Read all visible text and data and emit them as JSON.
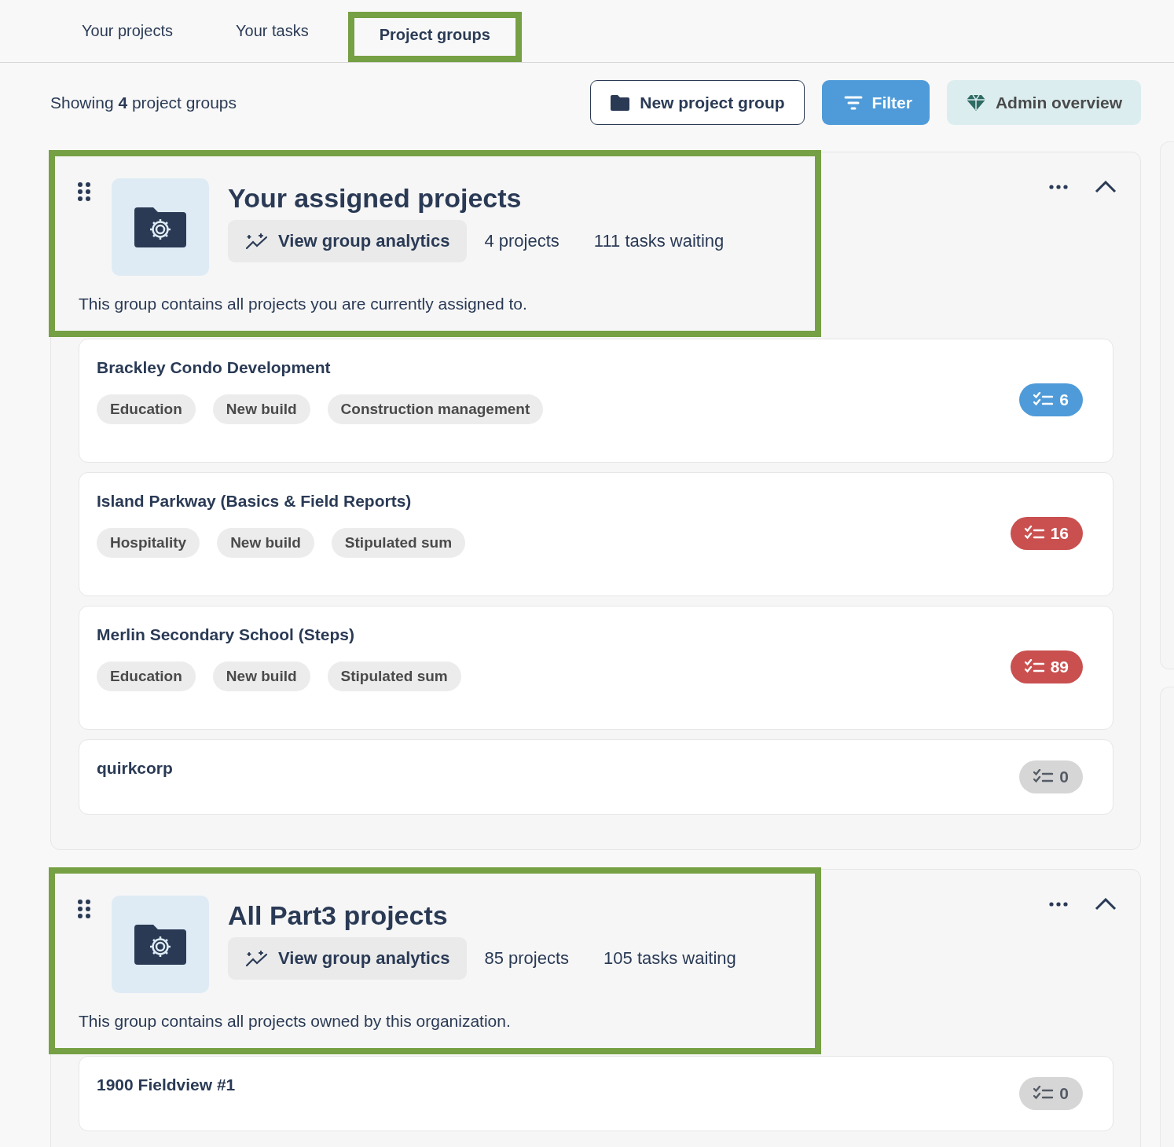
{
  "tabs": [
    {
      "label": "Your projects",
      "selected": false,
      "highlighted": false
    },
    {
      "label": "Your tasks",
      "selected": false,
      "highlighted": false
    },
    {
      "label": "Project groups",
      "selected": true,
      "highlighted": true
    }
  ],
  "toolbar": {
    "summary": "Showing **4** project groups",
    "buttons": [
      {
        "kind": "outline",
        "label": "New project group"
      },
      {
        "kind": "primary",
        "label": "Filter"
      },
      {
        "kind": "soft",
        "label": "Admin overview"
      }
    ]
  },
  "groups": [
    {
      "title": "Your assigned projects",
      "highlighted": true,
      "expanded": true,
      "analytics": "View group analytics",
      "projects_count": "4 projects",
      "tasks_waiting": "111 tasks waiting",
      "description": "This group contains all projects you are currently assigned to.",
      "projects": [
        {
          "name": "Brackley Condo Development",
          "tags": [
            "Education",
            "New build",
            "Construction management"
          ],
          "tasks": "6",
          "color": "#4f9bd9"
        },
        {
          "name": "Island Parkway (Basics & Field Reports)",
          "tags": [
            "Hospitality",
            "New build",
            "Stipulated sum"
          ],
          "tasks": "16",
          "color": "#c9504f"
        },
        {
          "name": "Merlin Secondary School (Steps)",
          "tags": [
            "Education",
            "New build",
            "Stipulated sum"
          ],
          "tasks": "89",
          "color": "#c9504f"
        },
        {
          "name": "quirkcorp",
          "tasks": "0",
          "color": "#d6d6d6"
        }
      ]
    },
    {
      "title": "All Part3 projects",
      "highlighted": true,
      "expanded": true,
      "analytics": "View group analytics",
      "projects_count": "85 projects",
      "tasks_waiting": "105 tasks waiting",
      "description": "This group contains all projects owned by this organization.",
      "projects": [
        {
          "name": "1900 Fieldview #1",
          "tasks": "0",
          "color": "#d6d6d6"
        }
      ]
    }
  ]
}
